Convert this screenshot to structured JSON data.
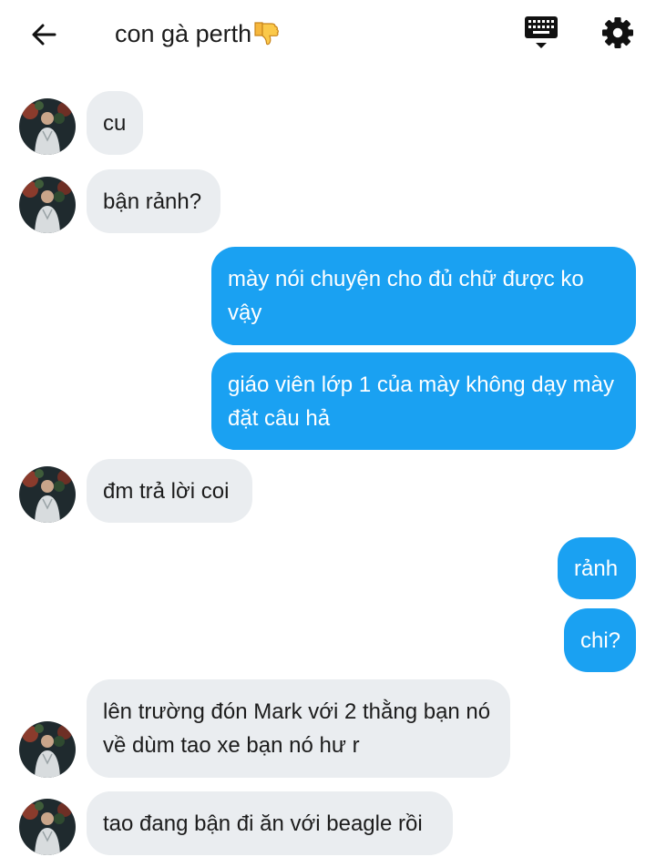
{
  "header": {
    "title": "con gà perth"
  },
  "icons": {
    "back": "arrow-left-icon",
    "keyboard": "keyboard-icon",
    "settings": "gear-icon",
    "title_emoji": "thumbs-down-emoji",
    "avatar": "contact-avatar"
  },
  "colors": {
    "outgoing_bubble": "#1aa1f2",
    "incoming_bubble": "#eaedf0",
    "text": "#1c1c1c"
  },
  "messages": [
    {
      "side": "in",
      "text": "cu"
    },
    {
      "side": "in",
      "text": "bận rảnh?"
    },
    {
      "side": "out",
      "text": "mày nói chuyện cho đủ chữ được ko vậy"
    },
    {
      "side": "out",
      "text": "giáo viên lớp 1 của mày không dạy mày đặt câu hả"
    },
    {
      "side": "in",
      "text": "đm trả lời coi"
    },
    {
      "side": "out",
      "text": "rảnh"
    },
    {
      "side": "out",
      "text": "chi?"
    },
    {
      "side": "in",
      "text": "lên trường đón Mark với 2 thằng bạn nó về dùm tao xe bạn nó hư r"
    },
    {
      "side": "in",
      "text": "tao đang bận đi ăn với beagle rồi"
    }
  ]
}
